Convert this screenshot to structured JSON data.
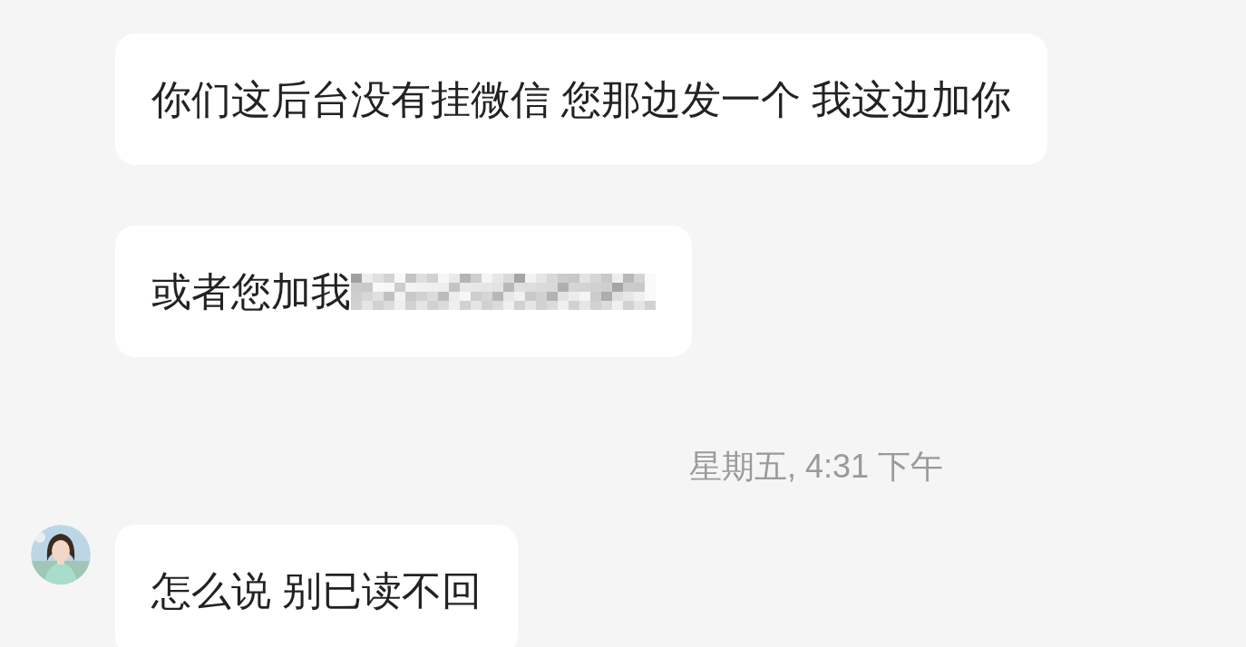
{
  "messages": [
    {
      "kind": "bubble",
      "text": "你们这后台没有挂微信 您那边发一个 我这边加你",
      "avatar": false,
      "redacted": false
    },
    {
      "kind": "bubble",
      "text": "或者您加我",
      "avatar": false,
      "redacted": true
    },
    {
      "kind": "timestamp",
      "text": "星期五, 4:31 下午"
    },
    {
      "kind": "bubble",
      "text": "怎么说 别已读不回",
      "avatar": true,
      "redacted": false
    }
  ]
}
